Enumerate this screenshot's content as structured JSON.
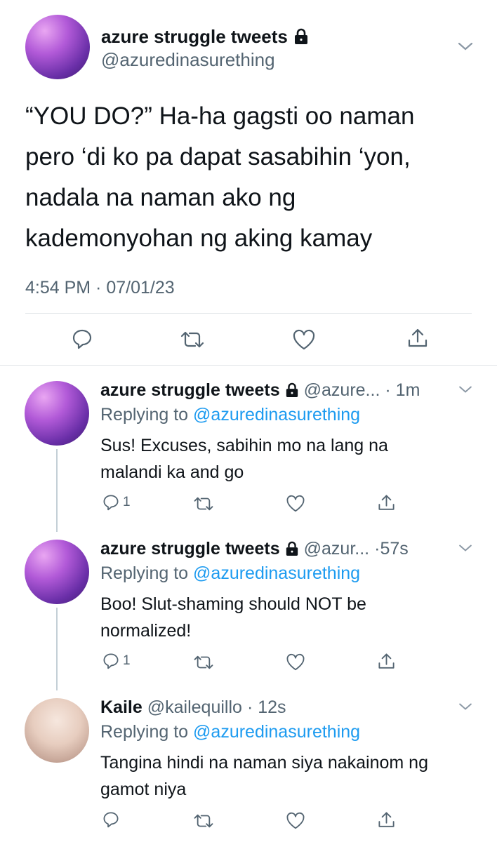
{
  "main_tweet": {
    "name": "azure struggle tweets",
    "handle": "@azuredinasurething",
    "text_lines": [
      "“YOU DO?” Ha-ha gagsti oo naman",
      "pero ‘di ko pa dapat sasabihin ‘yon,",
      "nadala na naman ako ng",
      "kademonyohan ng aking kamay"
    ],
    "timestamp": "4:54 PM · 07/01/23"
  },
  "replies": [
    {
      "name": "azure struggle tweets",
      "handle": "@azure...",
      "time": "· 1m",
      "replying_label": "Replying to",
      "replying_to": "@azuredinasurething",
      "text_lines": [
        "Sus! Excuses, sabihin mo na lang na",
        "malandi ka and go"
      ],
      "reply_count": "1"
    },
    {
      "name": "azure struggle tweets",
      "handle": "@azur...",
      "time": "·57s",
      "replying_label": "Replying to",
      "replying_to": "@azuredinasurething",
      "text_lines": [
        "Boo! Slut-shaming should NOT be",
        "normalized!"
      ],
      "reply_count": "1"
    },
    {
      "name": "Kaile",
      "handle": "@kailequillo",
      "time": "· 12s",
      "replying_label": "Replying to",
      "replying_to": "@azuredinasurething",
      "text_lines": [
        "Tangina hindi na naman siya nakainom ng",
        "gamot niya"
      ],
      "reply_count": ""
    }
  ],
  "icons": {
    "lock": "lock-icon",
    "chevron": "chevron-down-icon",
    "reply": "reply-icon",
    "retweet": "retweet-icon",
    "like": "heart-icon",
    "share": "share-icon"
  },
  "colors": {
    "link": "#1d9bf0",
    "secondary_text": "#536471",
    "divider": "#e1e5e8"
  }
}
